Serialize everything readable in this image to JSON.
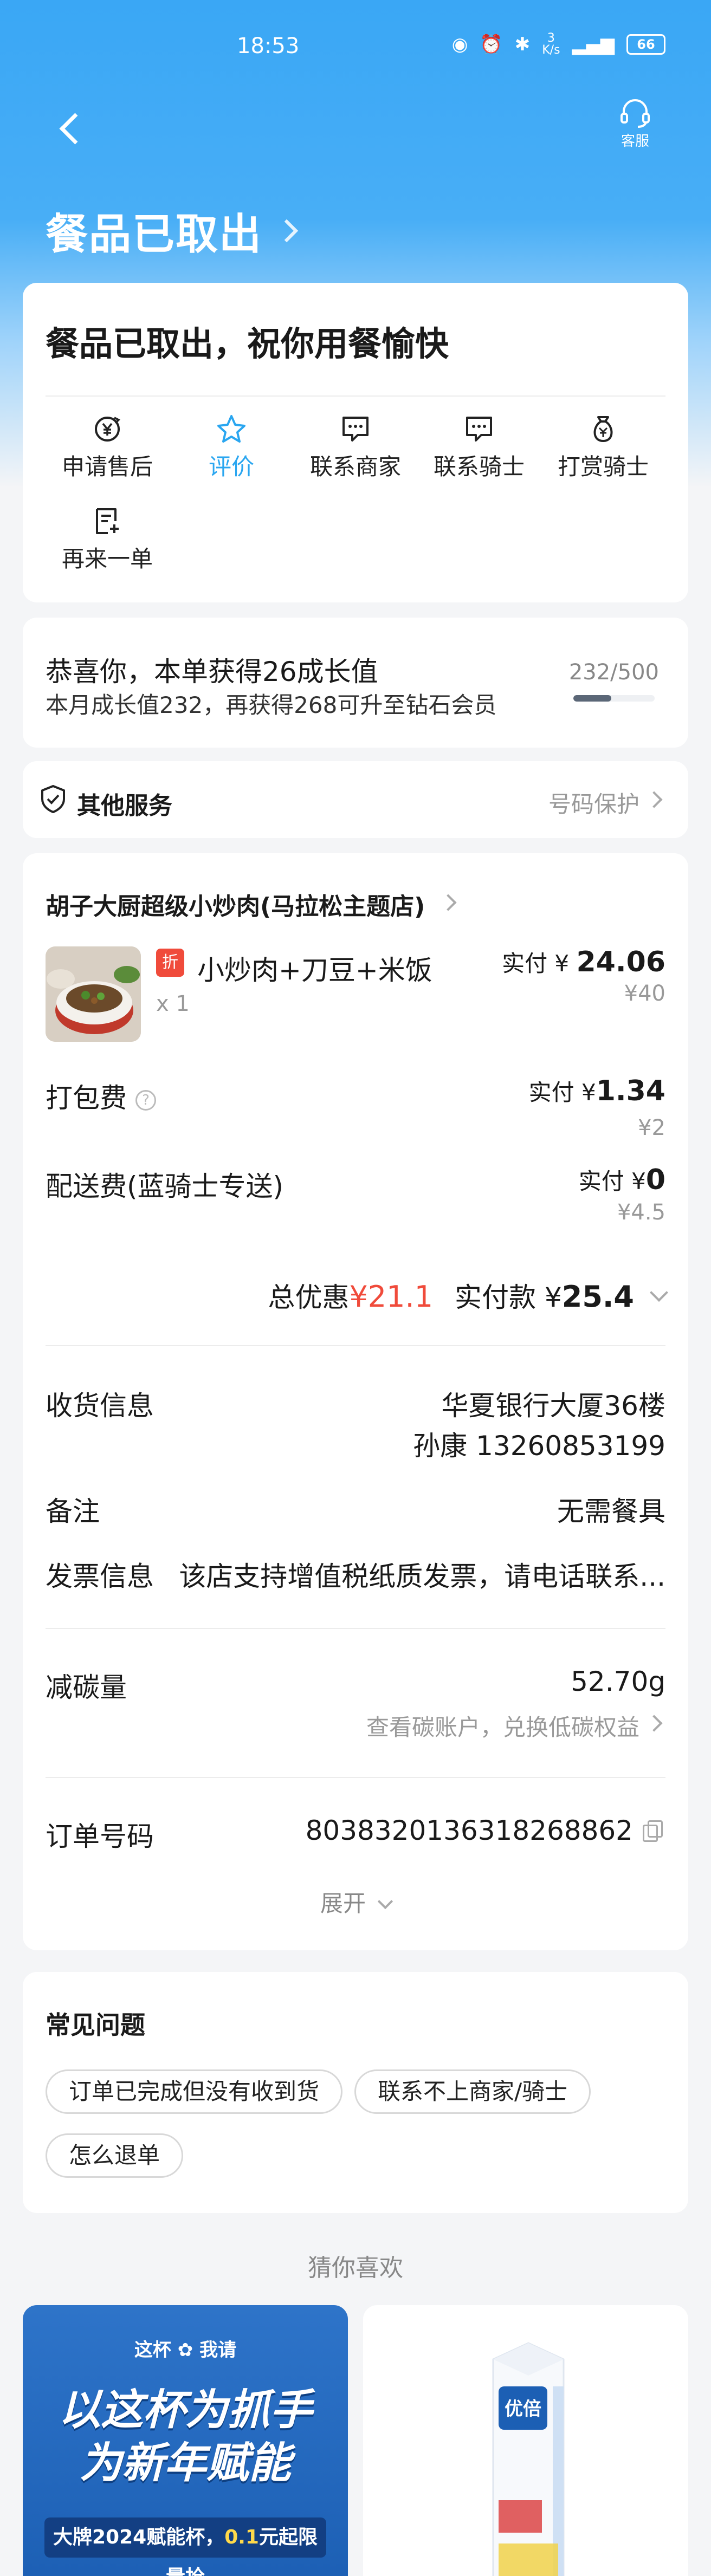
{
  "status_bar": {
    "time": "18:53",
    "net_speed": "3\nK/s",
    "battery": "66"
  },
  "nav": {
    "service_label": "客服"
  },
  "title": "餐品已取出",
  "status_card": {
    "headline": "餐品已取出，祝你用餐愉快",
    "actions": [
      {
        "label": "申请售后",
        "icon": "yen-refund-icon"
      },
      {
        "label": "评价",
        "icon": "star-icon",
        "active": true
      },
      {
        "label": "联系商家",
        "icon": "chat-icon"
      },
      {
        "label": "联系骑士",
        "icon": "chat-icon"
      },
      {
        "label": "打赏骑士",
        "icon": "money-bag-icon"
      },
      {
        "label": "再来一单",
        "icon": "reorder-icon"
      }
    ]
  },
  "growth": {
    "line1": "恭喜你，本单获得26成长值",
    "line2": "本月成长值232，再获得268可升至钻石会员",
    "progress_text": "232/500",
    "progress": 0.464
  },
  "services": {
    "title": "其他服务",
    "right": "号码保护"
  },
  "order": {
    "shop": "胡子大厨超级小炒肉(马拉松主题店)",
    "item": {
      "badge": "折",
      "name": "小炒肉+刀豆+米饭",
      "qty": "x 1",
      "paid_prefix": "实付 ¥ ",
      "paid": "24.06",
      "orig": "¥40"
    },
    "packing": {
      "label": "打包费",
      "help": "?",
      "paid_prefix": "实付 ¥",
      "paid": "1.34",
      "orig": "¥2"
    },
    "delivery": {
      "label": "配送费(蓝骑士专送)",
      "paid_prefix": "实付 ¥",
      "paid": "0",
      "orig": "¥4.5"
    },
    "totals": {
      "discount_label": "总优惠",
      "discount": "¥21.1",
      "pay_label": "实付款 ¥ ",
      "pay": "25.4"
    },
    "receive": {
      "label": "收货信息",
      "address": "华夏银行大厦36楼",
      "contact": "孙康 13260853199"
    },
    "remark": {
      "label": "备注",
      "value": "无需餐具"
    },
    "invoice": {
      "label": "发票信息",
      "value": "该店支持增值税纸质发票，请电话联系..."
    },
    "carbon": {
      "label": "减碳量",
      "value": "52.70g",
      "link": "查看碳账户，兑换低碳权益"
    },
    "order_no": {
      "label": "订单号码",
      "value": "8038320136318268862"
    },
    "expand": "展开"
  },
  "faq": {
    "title": "常见问题",
    "items": [
      "订单已完成但没有收到货",
      "联系不上商家/骑士",
      "怎么退单"
    ]
  },
  "guess": "猜你喜欢",
  "recommend": {
    "left": {
      "brand": "这杯 ✿ 我请",
      "headline1": "以这杯为抓手",
      "headline2": "为新年赋能",
      "strip_a": "大牌2024赋能杯，",
      "strip_b": "0.1",
      "strip_c": "元起限量抢"
    },
    "right": {
      "brand": "优倍"
    }
  },
  "colors": {
    "brand_blue": "#3aa7f5",
    "accent_blue": "#2aa6f0",
    "red": "#f04b3b"
  }
}
